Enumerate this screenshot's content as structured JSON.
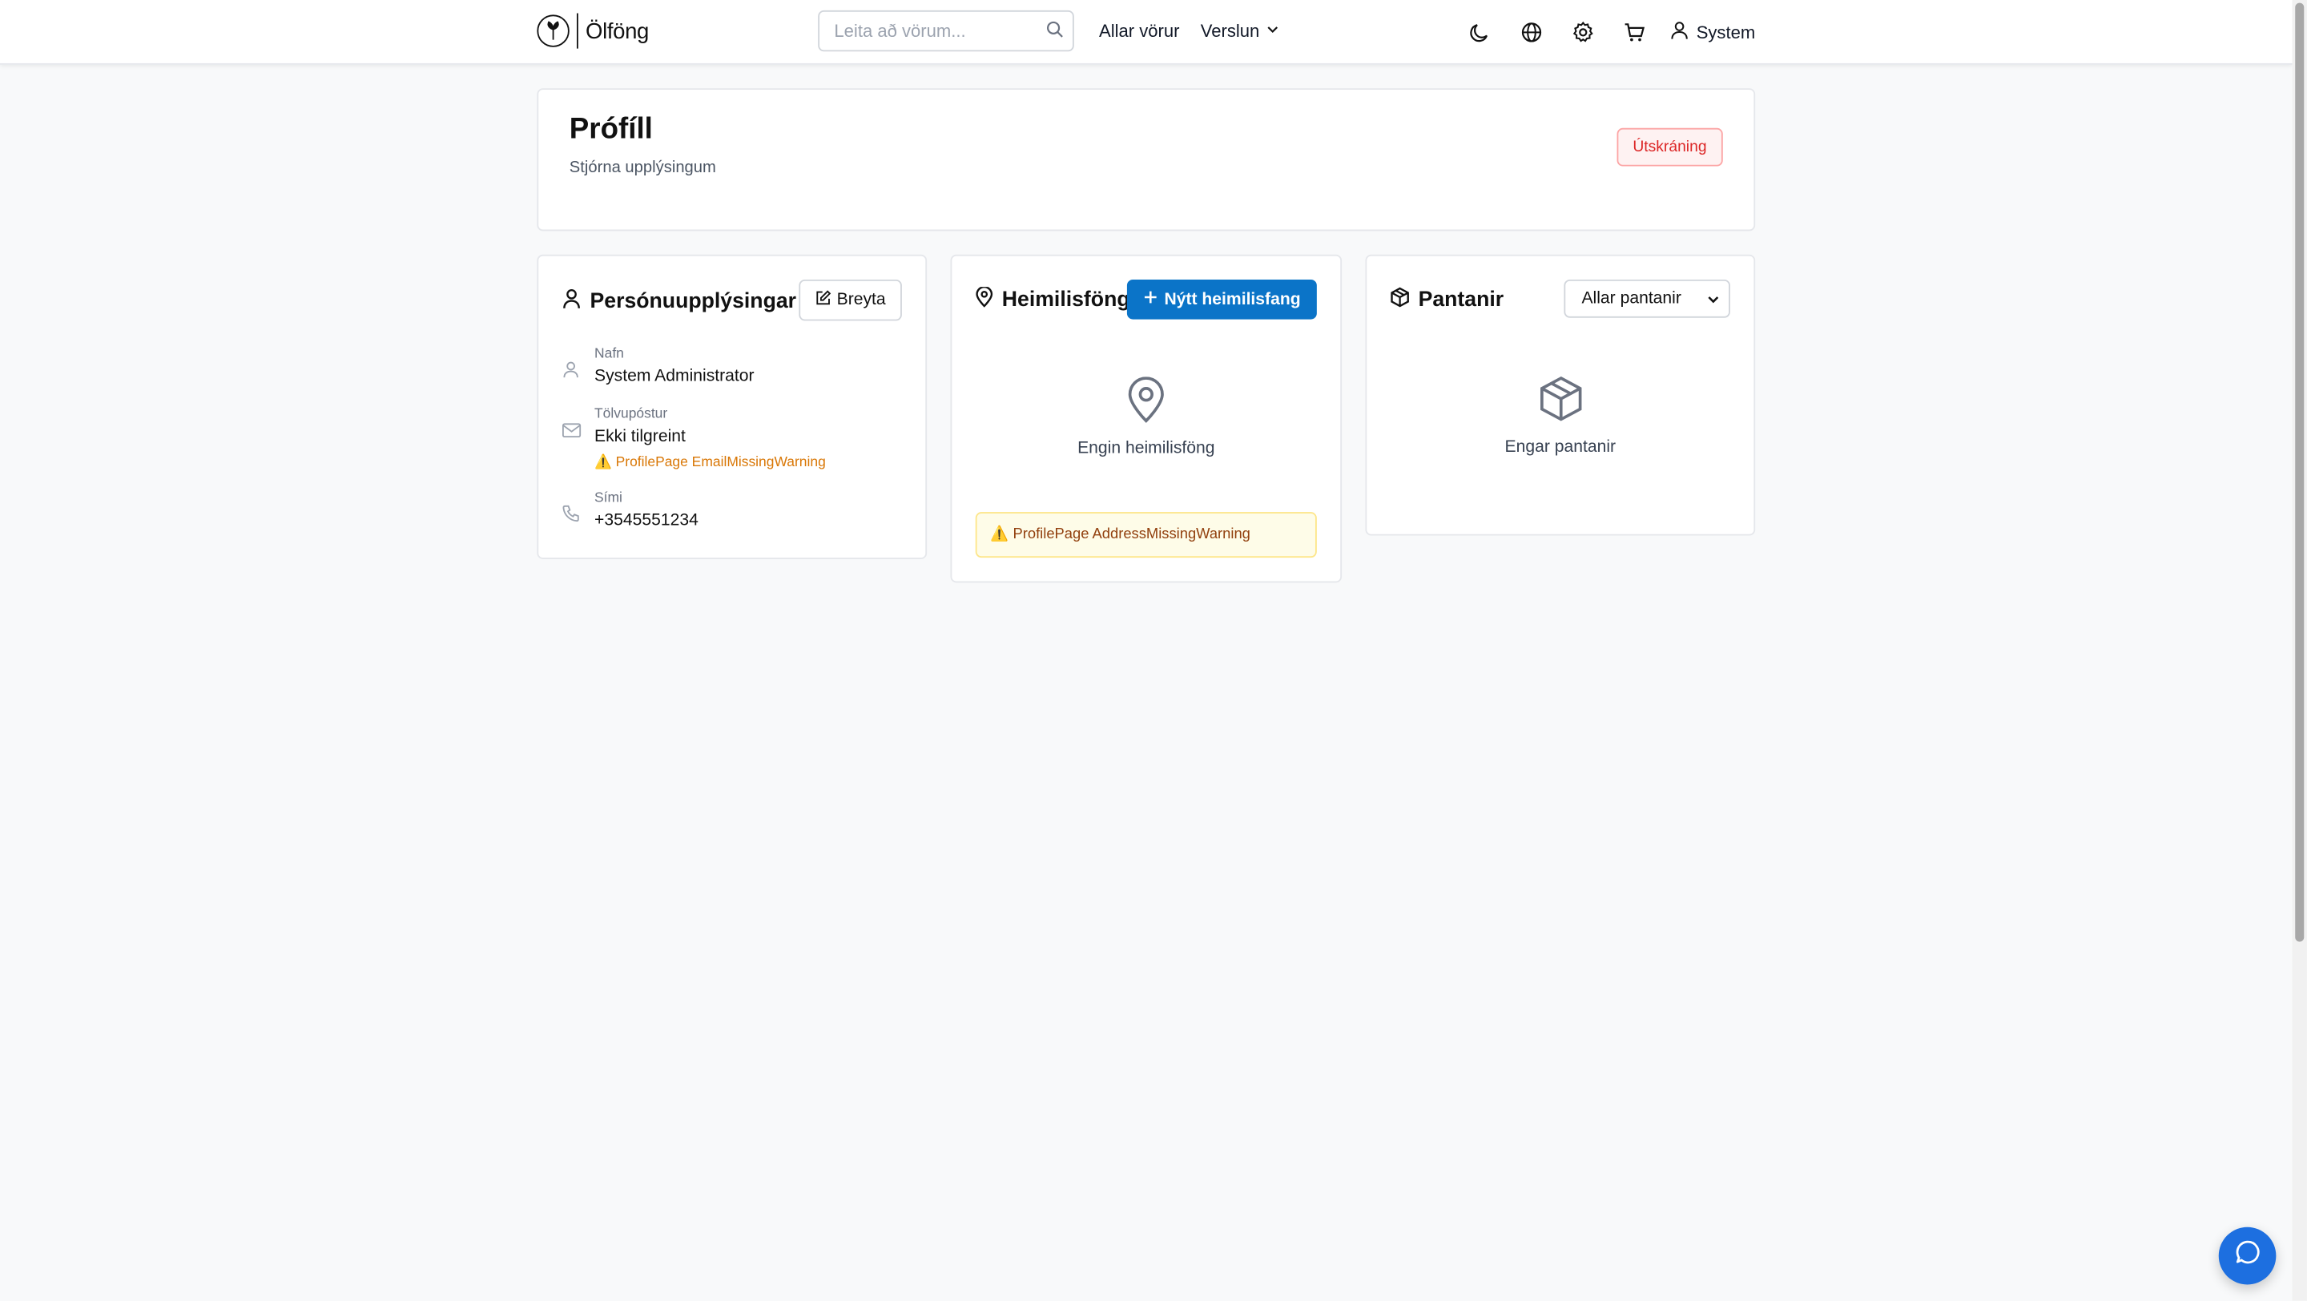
{
  "header": {
    "logo_text": "Ölföng",
    "search_placeholder": "Leita að vörum...",
    "nav": {
      "all_products": "Allar vörur",
      "shop": "Verslun"
    },
    "user_label": "System"
  },
  "profile": {
    "title": "Prófíll",
    "subtitle": "Stjórna upplýsingum",
    "logout_label": "Útskráning"
  },
  "personal": {
    "title": "Persónuupplýsingar",
    "edit_label": "Breyta",
    "name_label": "Nafn",
    "name_value": "System Administrator",
    "email_label": "Tölvupóstur",
    "email_value": "Ekki tilgreint",
    "email_warning": "ProfilePage EmailMissingWarning",
    "phone_label": "Sími",
    "phone_value": "+3545551234"
  },
  "addresses": {
    "title": "Heimilisföng",
    "new_label": "Nýtt heimilisfang",
    "empty_text": "Engin heimilisföng",
    "warning": "ProfilePage AddressMissingWarning"
  },
  "orders": {
    "title": "Pantanir",
    "filter_selected": "Allar pantanir",
    "empty_text": "Engar pantanir"
  },
  "colors": {
    "accent": "#0b74c8",
    "danger": "#dc2626",
    "warning": "#d97706",
    "chat": "#1d6fe0"
  }
}
